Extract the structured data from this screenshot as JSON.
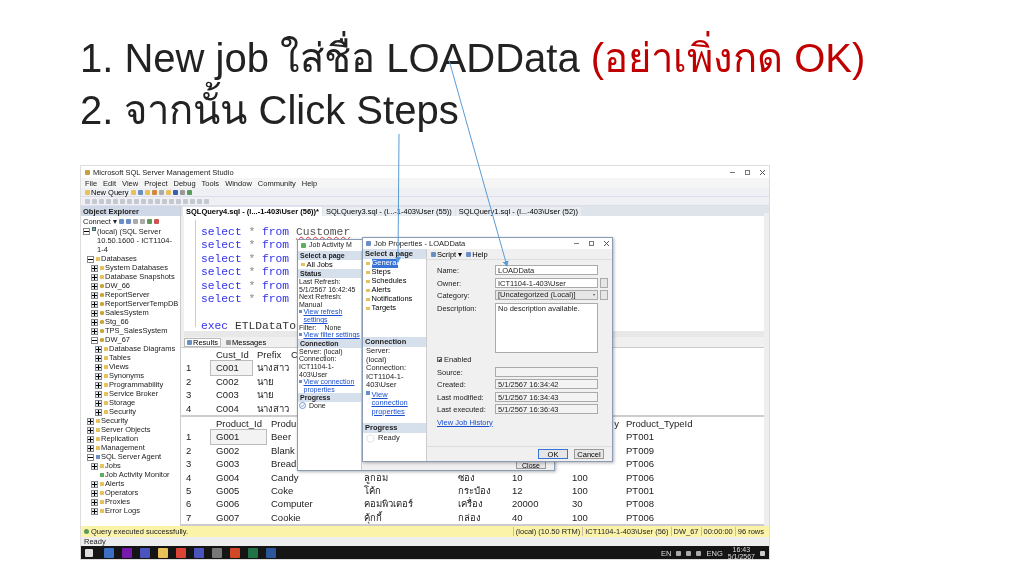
{
  "slide": {
    "title_lines": [
      [
        {
          "text": "1. New job ใส่ชื่อ LOADData ",
          "emphasis": false
        },
        {
          "text": "(อย่าเพิ่งกด OK)",
          "emphasis": true
        }
      ],
      [
        {
          "text": "2. จากนั้น Click Steps",
          "emphasis": false
        }
      ]
    ]
  },
  "ssms": {
    "title": "Microsoft SQL Server Management Studio",
    "menu": [
      "File",
      "Edit",
      "View",
      "Project",
      "Debug",
      "Tools",
      "Window",
      "Community",
      "Help"
    ],
    "new_query": "New Query",
    "object_explorer": {
      "title": "Object Explorer",
      "connect": "Connect ▾",
      "tree": [
        {
          "label": "(local) (SQL Server 10.50.1600 - ICT1104-1-4",
          "kind": "server",
          "expanded": true,
          "children": [
            {
              "label": "Databases",
              "kind": "folder",
              "expanded": true,
              "children": [
                {
                  "label": "System Databases",
                  "kind": "folder",
                  "expanded": false
                },
                {
                  "label": "Database Snapshots",
                  "kind": "folder",
                  "expanded": false
                },
                {
                  "label": "DW_66",
                  "kind": "database",
                  "expanded": false
                },
                {
                  "label": "ReportServer",
                  "kind": "database",
                  "expanded": false
                },
                {
                  "label": "ReportServerTempDB",
                  "kind": "database",
                  "expanded": false
                },
                {
                  "label": "SalesSystem",
                  "kind": "database",
                  "expanded": false
                },
                {
                  "label": "Stg_66",
                  "kind": "database",
                  "expanded": false
                },
                {
                  "label": "TPS_SalesSystem",
                  "kind": "database",
                  "expanded": false
                },
                {
                  "label": "DW_67",
                  "kind": "database",
                  "expanded": true,
                  "children": [
                    {
                      "label": "Database Diagrams",
                      "kind": "folder",
                      "expanded": false
                    },
                    {
                      "label": "Tables",
                      "kind": "folder",
                      "expanded": false
                    },
                    {
                      "label": "Views",
                      "kind": "folder",
                      "expanded": false
                    },
                    {
                      "label": "Synonyms",
                      "kind": "folder",
                      "expanded": false
                    },
                    {
                      "label": "Programmability",
                      "kind": "folder",
                      "expanded": false
                    },
                    {
                      "label": "Service Broker",
                      "kind": "folder",
                      "expanded": false
                    },
                    {
                      "label": "Storage",
                      "kind": "folder",
                      "expanded": false
                    },
                    {
                      "label": "Security",
                      "kind": "folder",
                      "expanded": false
                    }
                  ]
                }
              ]
            },
            {
              "label": "Security",
              "kind": "folder",
              "expanded": false
            },
            {
              "label": "Server Objects",
              "kind": "folder",
              "expanded": false
            },
            {
              "label": "Replication",
              "kind": "folder",
              "expanded": false
            },
            {
              "label": "Management",
              "kind": "folder",
              "expanded": false
            },
            {
              "label": "SQL Server Agent",
              "kind": "agent",
              "expanded": true,
              "children": [
                {
                  "label": "Jobs",
                  "kind": "folder",
                  "expanded": false
                },
                {
                  "label": "Job Activity Monitor",
                  "kind": "monitor"
                },
                {
                  "label": "Alerts",
                  "kind": "folder",
                  "expanded": false
                },
                {
                  "label": "Operators",
                  "kind": "folder",
                  "expanded": false
                },
                {
                  "label": "Proxies",
                  "kind": "folder",
                  "expanded": false
                },
                {
                  "label": "Error Logs",
                  "kind": "folder",
                  "expanded": false
                }
              ]
            }
          ]
        }
      ]
    },
    "doc_tabs": [
      {
        "label": "SQLQuery4.sql - (l...-1-403\\User (56))*",
        "selected": true
      },
      {
        "label": "SQLQuery3.sql - (l...-1-403\\User (55))",
        "selected": false
      },
      {
        "label": "SQLQuery1.sql - (l...-403\\User (52))",
        "selected": false
      }
    ],
    "editor_lines": [
      [
        {
          "kind": "keyword",
          "text": "select"
        },
        {
          "kind": "operator",
          "text": " * "
        },
        {
          "kind": "keyword",
          "text": "from "
        },
        {
          "kind": "unresolved",
          "text": "Customer"
        }
      ],
      [
        {
          "kind": "keyword",
          "text": "select"
        },
        {
          "kind": "operator",
          "text": " * "
        },
        {
          "kind": "keyword",
          "text": "from"
        }
      ],
      [
        {
          "kind": "keyword",
          "text": "select"
        },
        {
          "kind": "operator",
          "text": " * "
        },
        {
          "kind": "keyword",
          "text": "from"
        }
      ],
      [
        {
          "kind": "keyword",
          "text": "select"
        },
        {
          "kind": "operator",
          "text": " * "
        },
        {
          "kind": "keyword",
          "text": "from"
        }
      ],
      [
        {
          "kind": "keyword",
          "text": "select"
        },
        {
          "kind": "operator",
          "text": " * "
        },
        {
          "kind": "keyword",
          "text": "from"
        }
      ],
      [
        {
          "kind": "keyword",
          "text": "select"
        },
        {
          "kind": "operator",
          "text": " * "
        },
        {
          "kind": "keyword",
          "text": "from"
        }
      ],
      [
        {
          "kind": "keyword",
          "text": "exec"
        },
        {
          "kind": "plain",
          "text": " ETLDataTo"
        }
      ]
    ],
    "result_tabs": [
      {
        "label": "Results",
        "selected": true
      },
      {
        "label": "Messages",
        "selected": false
      }
    ],
    "grids": [
      {
        "columns": [
          "Cust_Id",
          "Prefix",
          "C"
        ],
        "rows": [
          {
            "number": "1",
            "selected": true,
            "cells": [
              "C001",
              "นางสาว",
              null
            ]
          },
          {
            "number": "2",
            "selected": false,
            "cells": [
              "C002",
              "นาย",
              null
            ]
          },
          {
            "number": "3",
            "selected": false,
            "cells": [
              "C003",
              "นาย",
              null
            ]
          },
          {
            "number": "4",
            "selected": false,
            "cells": [
              "C004",
              "นางสาว",
              null
            ]
          }
        ]
      },
      {
        "columns": [
          "Product_Id",
          "Produ",
          null,
          null,
          null,
          "y",
          "Product_TypeId"
        ],
        "rows": [
          {
            "number": "1",
            "selected": true,
            "cells": [
              "G001",
              "Beer",
              null,
              null,
              null,
              null,
              "PT001"
            ]
          },
          {
            "number": "2",
            "selected": false,
            "cells": [
              "G002",
              "Blank",
              null,
              null,
              null,
              null,
              "PT009"
            ]
          },
          {
            "number": "3",
            "selected": false,
            "cells": [
              "G003",
              "Bread",
              null,
              null,
              null,
              null,
              "PT006"
            ]
          },
          {
            "number": "4",
            "selected": false,
            "cells": [
              "G004",
              "Candy",
              "ลูกอม",
              "ซอง",
              "10",
              "100",
              "PT006"
            ]
          },
          {
            "number": "5",
            "selected": false,
            "cells": [
              "G005",
              "Coke",
              "โค้ก",
              "กระป๋อง",
              "12",
              "100",
              "PT001"
            ]
          },
          {
            "number": "6",
            "selected": false,
            "cells": [
              "G006",
              "Computer",
              "คอมพิวเตอร์",
              "เครื่อง",
              "20000",
              "30",
              "PT008"
            ]
          },
          {
            "number": "7",
            "selected": false,
            "cells": [
              "G007",
              "Cookie",
              "คุ้กกี้",
              "กล่อง",
              "40",
              "100",
              "PT006"
            ]
          }
        ]
      }
    ],
    "query_status": "Query executed successfully.",
    "status_fields": [
      "(local) (10.50 RTM)",
      "ICT1104-1-403\\User (56)",
      "DW_67",
      "00:00:00",
      "96 rows"
    ],
    "ready": "Ready",
    "tray": {
      "language": "EN",
      "keyboard": "ENG",
      "time": "16:43",
      "date": "5/1/2567"
    }
  },
  "job_activity_monitor": {
    "title": "Job Activity M",
    "select_header": "Select a page",
    "pages": [
      "All Jobs"
    ],
    "status_header": "Status",
    "status_lines": [
      "Last Refresh:",
      "5/1/2567 16:42:45",
      "Next Refresh:",
      "Manual"
    ],
    "refresh_link": "View refresh settings",
    "filter_label": "Filter:",
    "filter_value": "None",
    "filter_link": "View filter settings",
    "connection_header": "Connection",
    "connection_lines": [
      "Server: (local)",
      "Connection: ICT1104-1-403\\User"
    ],
    "connection_link": "View connection properties",
    "progress_header": "Progress",
    "progress": "Done",
    "close": "Close"
  },
  "job_properties": {
    "title": "Job Properties - LOADData",
    "select_header": "Select a page",
    "pages": [
      {
        "label": "General",
        "selected": true
      },
      {
        "label": "Steps",
        "selected": false
      },
      {
        "label": "Schedules",
        "selected": false
      },
      {
        "label": "Alerts",
        "selected": false
      },
      {
        "label": "Notifications",
        "selected": false
      },
      {
        "label": "Targets",
        "selected": false
      }
    ],
    "script": "Script ▾",
    "help": "Help",
    "fields": [
      {
        "label": "Name:",
        "value": "LOADData",
        "kind": "text"
      },
      {
        "label": "Owner:",
        "value": "ICT1104-1-403\\User",
        "kind": "browse"
      },
      {
        "label": "Category:",
        "value": "[Uncategorized (Local)]",
        "kind": "dropdown"
      },
      {
        "label": "Description:",
        "value": "No description available.",
        "kind": "memo"
      }
    ],
    "enabled": {
      "label": "Enabled",
      "checked": true
    },
    "info": [
      {
        "label": "Source:"
      },
      {
        "label": "Created:",
        "value": "5/1/2567 16:34:42"
      },
      {
        "label": "Last modified:",
        "value": "5/1/2567 16:34:43"
      },
      {
        "label": "Last executed:",
        "value": "5/1/2567 16:36:43"
      }
    ],
    "history_link": "View Job History",
    "connection_header": "Connection",
    "connection_lines": [
      "Server:",
      "(local)",
      "Connection:",
      "ICT1104-1-403\\User"
    ],
    "connection_link": "View connection properties",
    "progress_header": "Progress",
    "progress": "Ready",
    "buttons": [
      "OK",
      "Cancel"
    ]
  }
}
